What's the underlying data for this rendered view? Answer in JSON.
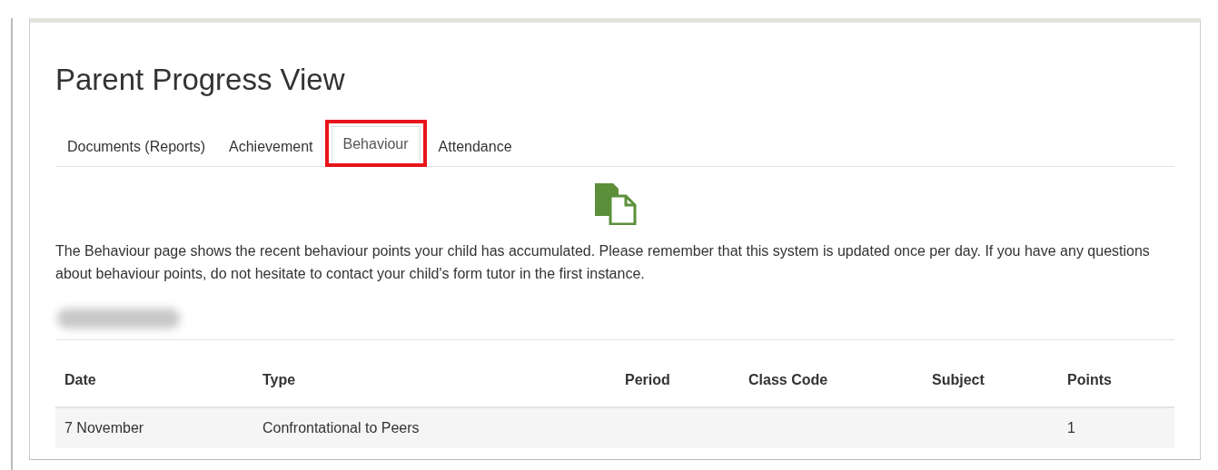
{
  "title": "Parent Progress View",
  "tabs": [
    {
      "label": "Documents (Reports)",
      "selected": false,
      "highlighted": false
    },
    {
      "label": "Achievement",
      "selected": false,
      "highlighted": false
    },
    {
      "label": "Behaviour",
      "selected": true,
      "highlighted": true
    },
    {
      "label": "Attendance",
      "selected": false,
      "highlighted": false
    }
  ],
  "intro": "The Behaviour page shows the recent behaviour points your child has accumulated. Please remember that this system is updated once per day. If you have any questions about behaviour points, do not hesitate to contact your child's form tutor in the first instance.",
  "table": {
    "columns": [
      "Date",
      "Type",
      "Period",
      "Class Code",
      "Subject",
      "Points"
    ],
    "rows": [
      [
        "7 November",
        "Confrontational to Peers",
        "",
        "",
        "",
        "1"
      ]
    ]
  }
}
